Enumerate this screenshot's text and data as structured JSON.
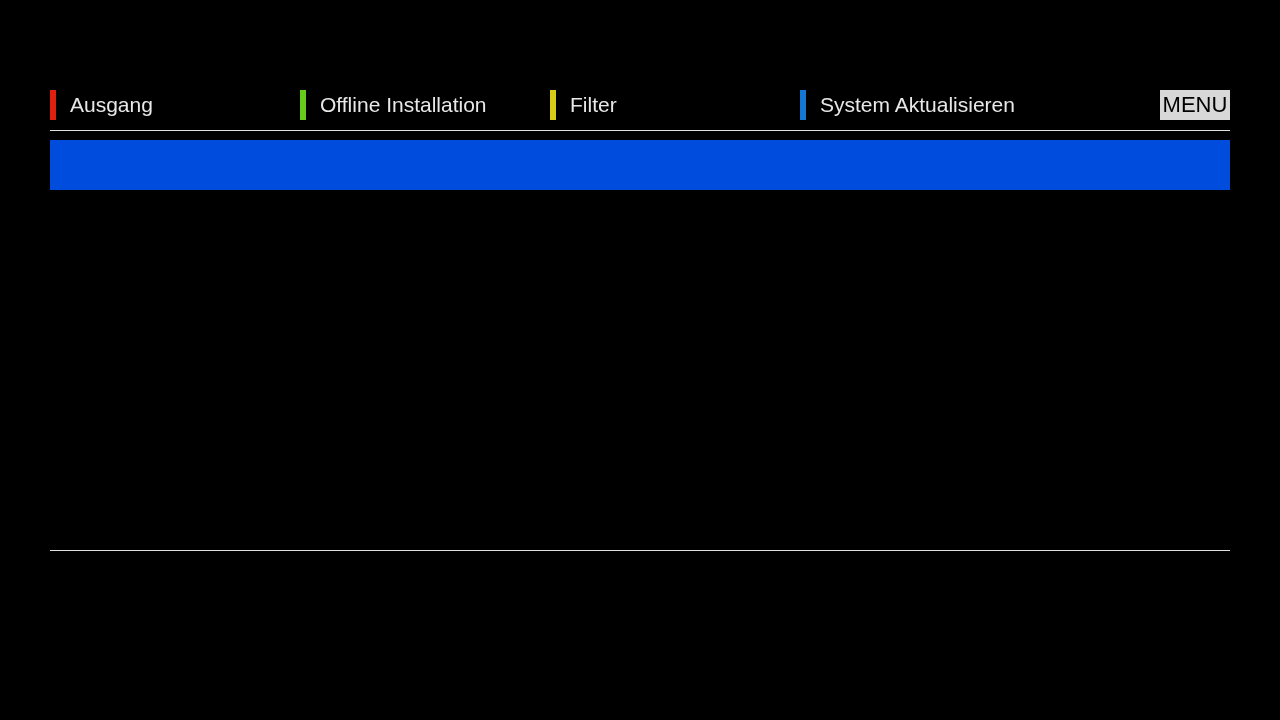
{
  "color_keys": [
    {
      "label": "Ausgang",
      "color": "#e0200e"
    },
    {
      "label": "Offline Installation",
      "color": "#66cc1a"
    },
    {
      "label": "Filter",
      "color": "#d9cc17"
    },
    {
      "label": "System Aktualisieren",
      "color": "#1577d4"
    }
  ],
  "menu_key": {
    "label": "MENU"
  },
  "list": {
    "rows": [
      {
        "selected": true
      }
    ]
  }
}
